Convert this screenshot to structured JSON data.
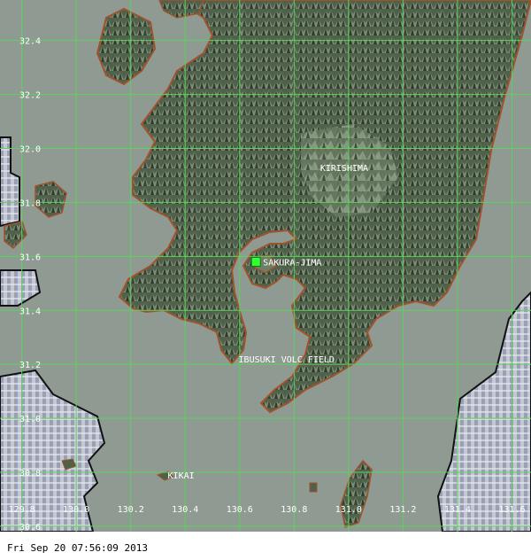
{
  "map": {
    "lat_labels": [
      "32.4",
      "32.2",
      "32.0",
      "31.8",
      "31.6",
      "31.4",
      "31.2",
      "31.0",
      "30.8",
      "30.6"
    ],
    "lon_labels": [
      "129.8",
      "130.0",
      "130.2",
      "130.4",
      "130.6",
      "130.8",
      "131.0",
      "131.2",
      "131.4",
      "131.6"
    ],
    "lat_range": [
      30.58,
      32.55
    ],
    "lon_range": [
      129.72,
      131.67
    ],
    "volcanoes": [
      {
        "name": "KIRISHIMA",
        "lat": 31.93,
        "lon": 130.87,
        "active": false
      },
      {
        "name": "SAKURA-JIMA",
        "lat": 31.58,
        "lon": 130.66,
        "active": true
      },
      {
        "name": "IBUSUKI VOLC FIELD",
        "lat": 31.22,
        "lon": 130.57,
        "active": false
      },
      {
        "name": "KIKAI",
        "lat": 30.79,
        "lon": 130.31,
        "active": false
      }
    ],
    "colors": {
      "sea": "#8e9a92",
      "land": "#5a6e55",
      "grid": "#5ad45a",
      "coast": "#a0522d",
      "hotspot": "#33ff33",
      "cloud": "#b8bcc8"
    }
  },
  "footer": {
    "timestamp": "Fri Sep 20 07:56:09 2013"
  }
}
